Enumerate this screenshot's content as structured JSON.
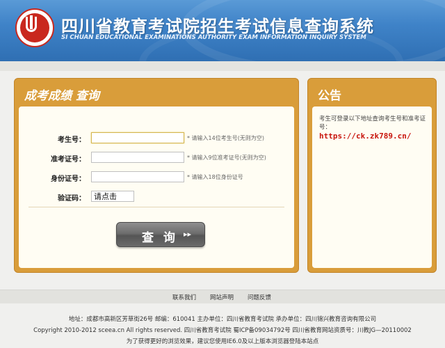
{
  "header": {
    "title": "四川省教育考试院招生考试信息查询系统",
    "subtitle": "SI CHUAN EDUCATIONAL EXAMINATIONS AUTHORITY EXAM INFORMATION INQUIRY SYSTEM"
  },
  "query_panel": {
    "title": "成考成绩  查询",
    "fields": [
      {
        "label": "考生号：",
        "value": "",
        "hint": "* 请输入14位考生号(无则为空)"
      },
      {
        "label": "准考证号：",
        "value": "",
        "hint": "* 请输入9位准考证号(无则为空)"
      },
      {
        "label": "身份证号：",
        "value": "",
        "hint": "* 请输入18位身份证号"
      }
    ],
    "captcha_label": "验证码：",
    "captcha_value": "请点击",
    "submit_label": "查 询",
    "submit_icon": "double-chevron-right"
  },
  "notice_panel": {
    "title": "公告",
    "text": "考生可登录以下地址查询考生号和准考证号：",
    "link": "https://ck.zk789.cn/"
  },
  "footer": {
    "links": [
      "联系我们",
      "网站声明",
      "问题反馈"
    ],
    "address": "地址：成都市高新区芳草街26号 邮编：610041      主办单位：四川省教育考试院 承办单位：四川锦兴教育咨询有限公司",
    "copyright": "Copyright 2010-2012 sceea.cn All rights reserved. 四川省教育考试院      蜀ICP备09034792号 四川省教育网站资质号：川教JG—20110002",
    "browser_note": "为了获得更好的浏览效果，建议您使用IE6.0及以上版本浏览器登陆本站点"
  },
  "colors": {
    "header_blue": "#3f83c8",
    "panel_orange": "#d99d3a",
    "link_red": "#c8150d"
  }
}
